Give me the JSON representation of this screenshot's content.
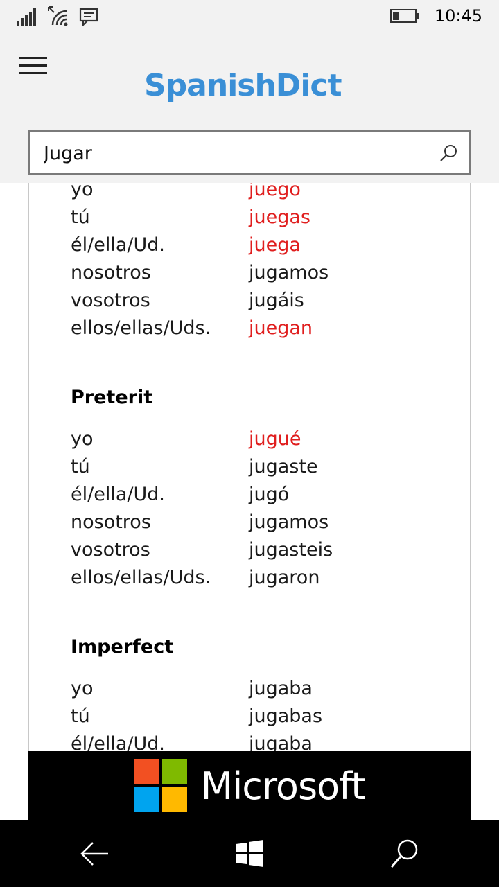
{
  "status_bar": {
    "time": "10:45",
    "icons": [
      "signal-icon",
      "wifi-icon",
      "message-icon",
      "battery-icon"
    ]
  },
  "header": {
    "logo_text": "SpanishDict",
    "brand_color": "#3a8fd6"
  },
  "search": {
    "value": "Jugar",
    "placeholder": ""
  },
  "conjugation": {
    "irregular_color": "#e01e1e",
    "present": [
      {
        "pronoun": "yo",
        "form": "juego",
        "irregular": true
      },
      {
        "pronoun": "tú",
        "form": "juegas",
        "irregular": true
      },
      {
        "pronoun": "él/ella/Ud.",
        "form": "juega",
        "irregular": true
      },
      {
        "pronoun": "nosotros",
        "form": "jugamos",
        "irregular": false
      },
      {
        "pronoun": "vosotros",
        "form": "jugáis",
        "irregular": false
      },
      {
        "pronoun": "ellos/ellas/Uds.",
        "form": "juegan",
        "irregular": true
      }
    ],
    "preterit": {
      "title": "Preterit",
      "rows": [
        {
          "pronoun": "yo",
          "form": "jugué",
          "irregular": true
        },
        {
          "pronoun": "tú",
          "form": "jugaste",
          "irregular": false
        },
        {
          "pronoun": "él/ella/Ud.",
          "form": "jugó",
          "irregular": false
        },
        {
          "pronoun": "nosotros",
          "form": "jugamos",
          "irregular": false
        },
        {
          "pronoun": "vosotros",
          "form": "jugasteis",
          "irregular": false
        },
        {
          "pronoun": "ellos/ellas/Uds.",
          "form": "jugaron",
          "irregular": false
        }
      ]
    },
    "imperfect": {
      "title": "Imperfect",
      "rows": [
        {
          "pronoun": "yo",
          "form": "jugaba",
          "irregular": false
        },
        {
          "pronoun": "tú",
          "form": "jugabas",
          "irregular": false
        },
        {
          "pronoun": "él/ella/Ud.",
          "form": "jugaba",
          "irregular": false
        }
      ]
    }
  },
  "ad": {
    "brand": "Microsoft",
    "colors": [
      "#f25022",
      "#7fba00",
      "#00a4ef",
      "#ffb900"
    ]
  },
  "nav": {
    "icons": [
      "back-arrow-icon",
      "windows-start-icon",
      "search-icon"
    ]
  }
}
